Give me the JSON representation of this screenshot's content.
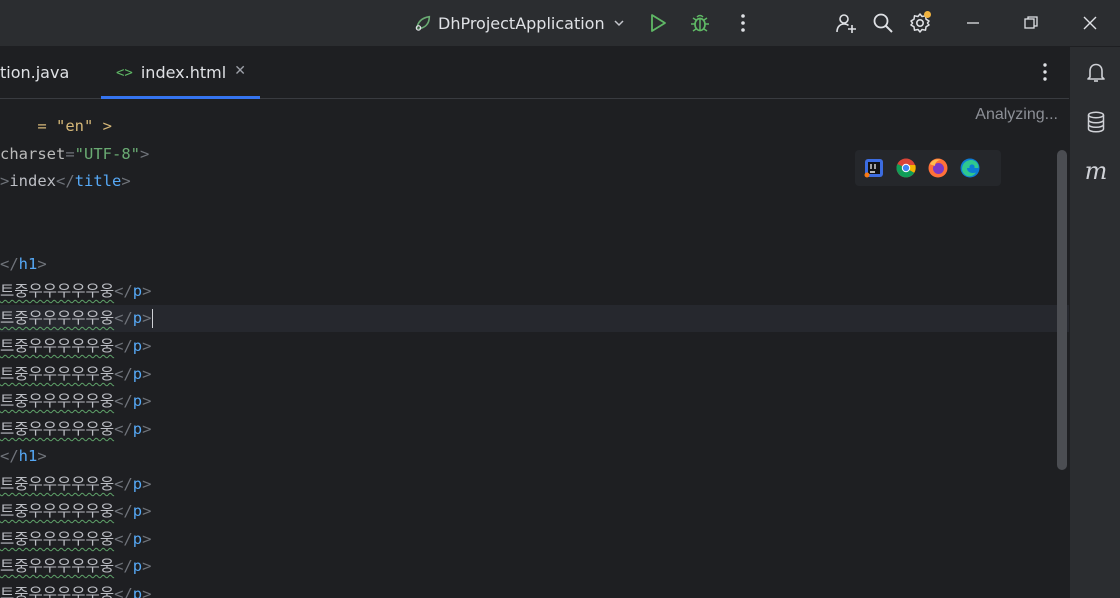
{
  "toolbar": {
    "run_config": "DhProjectApplication",
    "icons": [
      "spring-leaf-icon",
      "chevron-down-icon",
      "run-icon",
      "debug-icon",
      "more-icon",
      "add-user-icon",
      "search-icon",
      "settings-icon",
      "minimize-icon",
      "restore-icon",
      "close-icon"
    ]
  },
  "tabs": [
    {
      "label": "tion.java"
    },
    {
      "icon": "<>",
      "label": "index.html",
      "close": "✕"
    }
  ],
  "editor": {
    "status": "Analyzing...",
    "lines": [
      {
        "pre": "= \"en\" >"
      },
      {
        "attr": "charset",
        "eq": "=",
        "value": "\"UTF-8\"",
        "close": ">"
      },
      {
        "gt": ">",
        "text": "index",
        "endtag_open": "</",
        "endtag": "title",
        "endtag_close": ">"
      },
      {
        "open": "</",
        "name": "h1",
        "close": ">"
      },
      {
        "text": "트중우우우우우웅",
        "open": "</",
        "name": "p",
        "close": ">"
      },
      {
        "text": "트중우우우우우웅",
        "open": "</",
        "name": "p",
        "close": ">"
      },
      {
        "text": "트중우우우우우웅",
        "open": "</",
        "name": "p",
        "close": ">"
      },
      {
        "text": "트중우우우우우웅",
        "open": "</",
        "name": "p",
        "close": ">"
      },
      {
        "text": "트중우우우우우웅",
        "open": "</",
        "name": "p",
        "close": ">"
      },
      {
        "text": "트중우우우우우웅",
        "open": "</",
        "name": "p",
        "close": ">"
      },
      {
        "open": "</",
        "name": "h1",
        "close": ">"
      },
      {
        "text": "트중우우우우우웅",
        "open": "</",
        "name": "p",
        "close": ">"
      },
      {
        "text": "트중우우우우우웅",
        "open": "</",
        "name": "p",
        "close": ">"
      },
      {
        "text": "트중우우우우우웅",
        "open": "</",
        "name": "p",
        "close": ">"
      },
      {
        "text": "트중우우우우우웅",
        "open": "</",
        "name": "p",
        "close": ">"
      },
      {
        "text": "트중우우우우우웅",
        "open": "</",
        "name": "p",
        "close": ">"
      }
    ]
  },
  "rightbar": {
    "icons": [
      "notifications-icon",
      "database-icon",
      "maven-icon"
    ],
    "m_label": "m"
  },
  "colors": {
    "accent": "#3574f0",
    "tag_name": "#56a8f5",
    "string": "#6aab73",
    "badge": "#f2b440"
  }
}
